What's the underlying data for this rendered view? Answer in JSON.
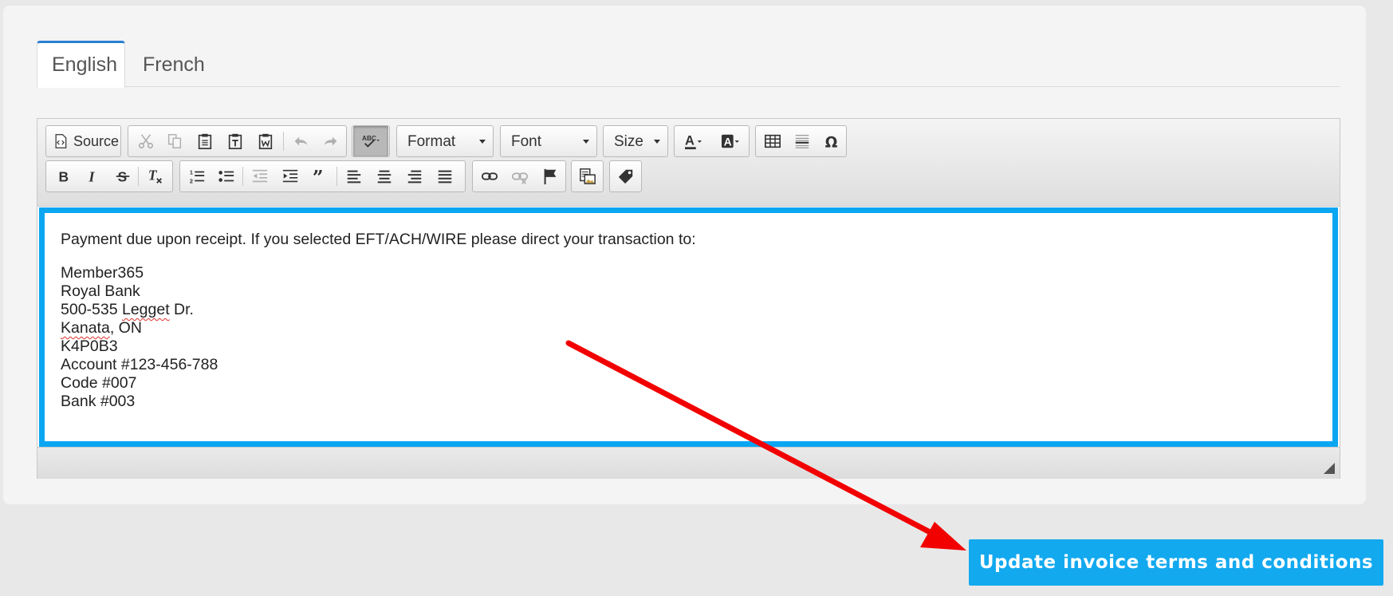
{
  "tabs": [
    {
      "label": "English",
      "active": true
    },
    {
      "label": "French",
      "active": false
    }
  ],
  "toolbar": {
    "source_label": "Source",
    "format_label": "Format",
    "font_label": "Font",
    "size_label": "Size"
  },
  "content": {
    "intro": "Payment due upon receipt.  If you selected EFT/ACH/WIRE please direct your transaction to:",
    "line1": "Member365",
    "line2": "Royal Bank",
    "line3_prefix": "500-535 ",
    "line3_word": "Legget",
    "line3_suffix": " Dr.",
    "line4_word": "Kanata",
    "line4_suffix": ", ON",
    "line5": "K4P0B3",
    "line6": "Account #123-456-788",
    "line7": "Code #007",
    "line8": "Bank #003"
  },
  "actions": {
    "update_label": "Update invoice terms and conditions"
  },
  "colors": {
    "accent": "#12a9ef",
    "editor_focus_border": "#0aa6f2",
    "annotation_arrow": "#f20000",
    "active_tab_border": "#2a7fd2"
  }
}
